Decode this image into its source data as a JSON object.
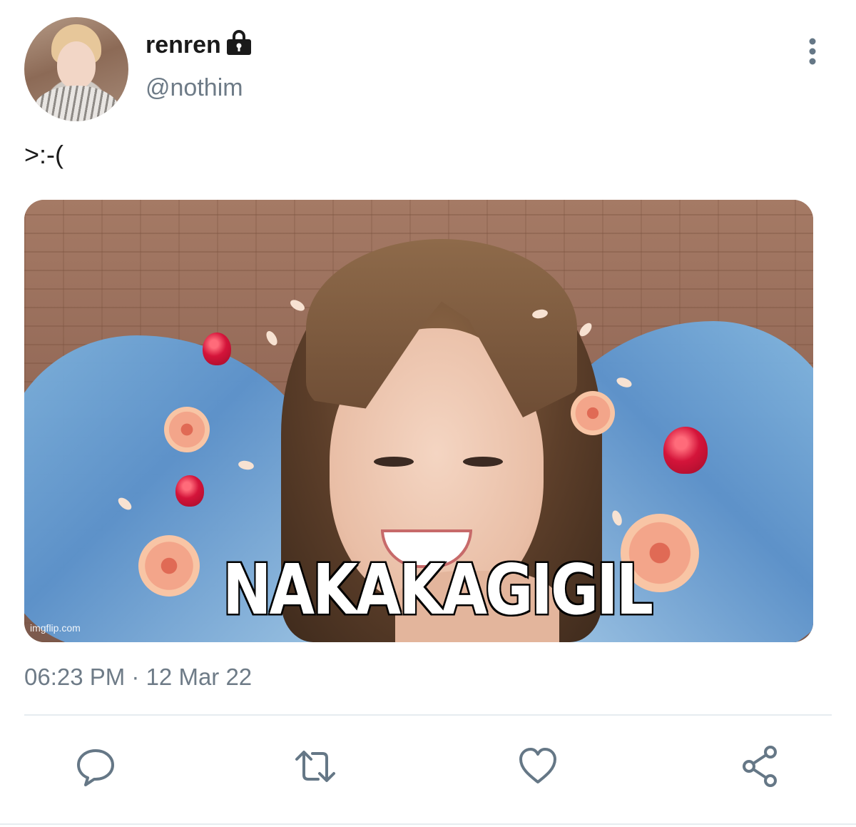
{
  "header": {
    "display_name": "renren",
    "handle": "@nothim",
    "lock_icon": "lock-icon",
    "more_icon": "more-vertical-icon"
  },
  "tweet": {
    "text": ">:-(",
    "media": {
      "caption": "NAKAKAGIGIL",
      "watermark": "imgflip.com"
    },
    "timestamp": "06:23 PM · 12 Mar 22"
  },
  "actions": [
    {
      "name": "reply",
      "icon": "reply-icon"
    },
    {
      "name": "retweet",
      "icon": "retweet-icon"
    },
    {
      "name": "like",
      "icon": "heart-icon"
    },
    {
      "name": "share",
      "icon": "share-icon"
    }
  ],
  "colors": {
    "text_primary": "#1a1a1a",
    "text_secondary": "#6e7b87",
    "divider": "#e6ecf0",
    "icon": "#657786"
  }
}
